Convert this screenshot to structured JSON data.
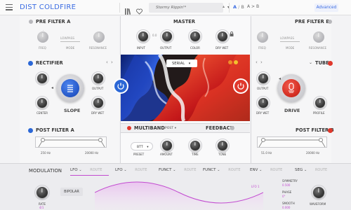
{
  "header": {
    "title": "DIST COLDFIRE",
    "preset_name": "Stormy Rippin'*",
    "ab_label": "A",
    "ab_alt": "B",
    "ab_copy": "A > B",
    "advanced": "Advanced"
  },
  "pre_filter_a": {
    "title": "PRE FILTER A",
    "mode_value": "LOWPASS",
    "knobs": [
      "FREQ",
      "MODE",
      "RESONANCE"
    ]
  },
  "pre_filter_b": {
    "title": "PRE FILTER B",
    "mode_value": "LOWPASS",
    "knobs": [
      "FREQ",
      "MODE",
      "RESONANCE"
    ]
  },
  "master": {
    "title": "MASTER",
    "knobs": [
      "INPUT",
      "OUTPUT",
      "COLOR",
      "DRY WET"
    ],
    "scale_mark": "0.0",
    "routing": "SERIAL"
  },
  "rectifier": {
    "title": "RECTIFIER",
    "knobs": [
      "OUTPUT",
      "DRY WET",
      "CENTER"
    ],
    "big_knob": "SLOPE"
  },
  "tube": {
    "title": "TUBE",
    "knobs": [
      "OUTPUT",
      "DRY WET",
      "PROFILE"
    ],
    "big_knob": "DRIVE"
  },
  "post_filter_a": {
    "title": "POST FILTER A",
    "low": "250 Hz",
    "high": "20000 Hz"
  },
  "post_filter_b": {
    "title": "POST FILTER B",
    "low": "51.0 Hz",
    "high": "20000 Hz"
  },
  "multiband": {
    "title": "MULTIBAND",
    "post_label": "POST",
    "feedback_title": "FEEDBACK",
    "preset_value": "BTT",
    "knobs": [
      "PRESET",
      "AMOUNT",
      "TIME",
      "TONE"
    ]
  },
  "modulation": {
    "title": "MODULATION",
    "tabs": [
      {
        "label": "LFO",
        "route": "ROUTE"
      },
      {
        "label": "LFO",
        "route": "ROUTE"
      },
      {
        "label": "FUNCT",
        "route": "ROUTE"
      },
      {
        "label": "FUNCT",
        "route": "ROUTE"
      },
      {
        "label": "ENV",
        "route": "ROUTE"
      },
      {
        "label": "SEG",
        "route": "ROUTE"
      }
    ],
    "rate_label": "RATE",
    "rate_value": "4/1",
    "bipolar": "BIPOLAR",
    "lfo_tag": "LFO 1",
    "symmetry_label": "SYMMETRY",
    "symmetry_value": "0.500",
    "phase_label": "PHASE",
    "phase_value": "0°",
    "smooth_label": "SMOOTH",
    "smooth_value": "0.000",
    "waveform_label": "WAVEFORM"
  },
  "colors": {
    "accent": "#3a6be2",
    "rectifier": "#2b67d6",
    "tube": "#e0382c",
    "mod": "#c24bd0"
  }
}
